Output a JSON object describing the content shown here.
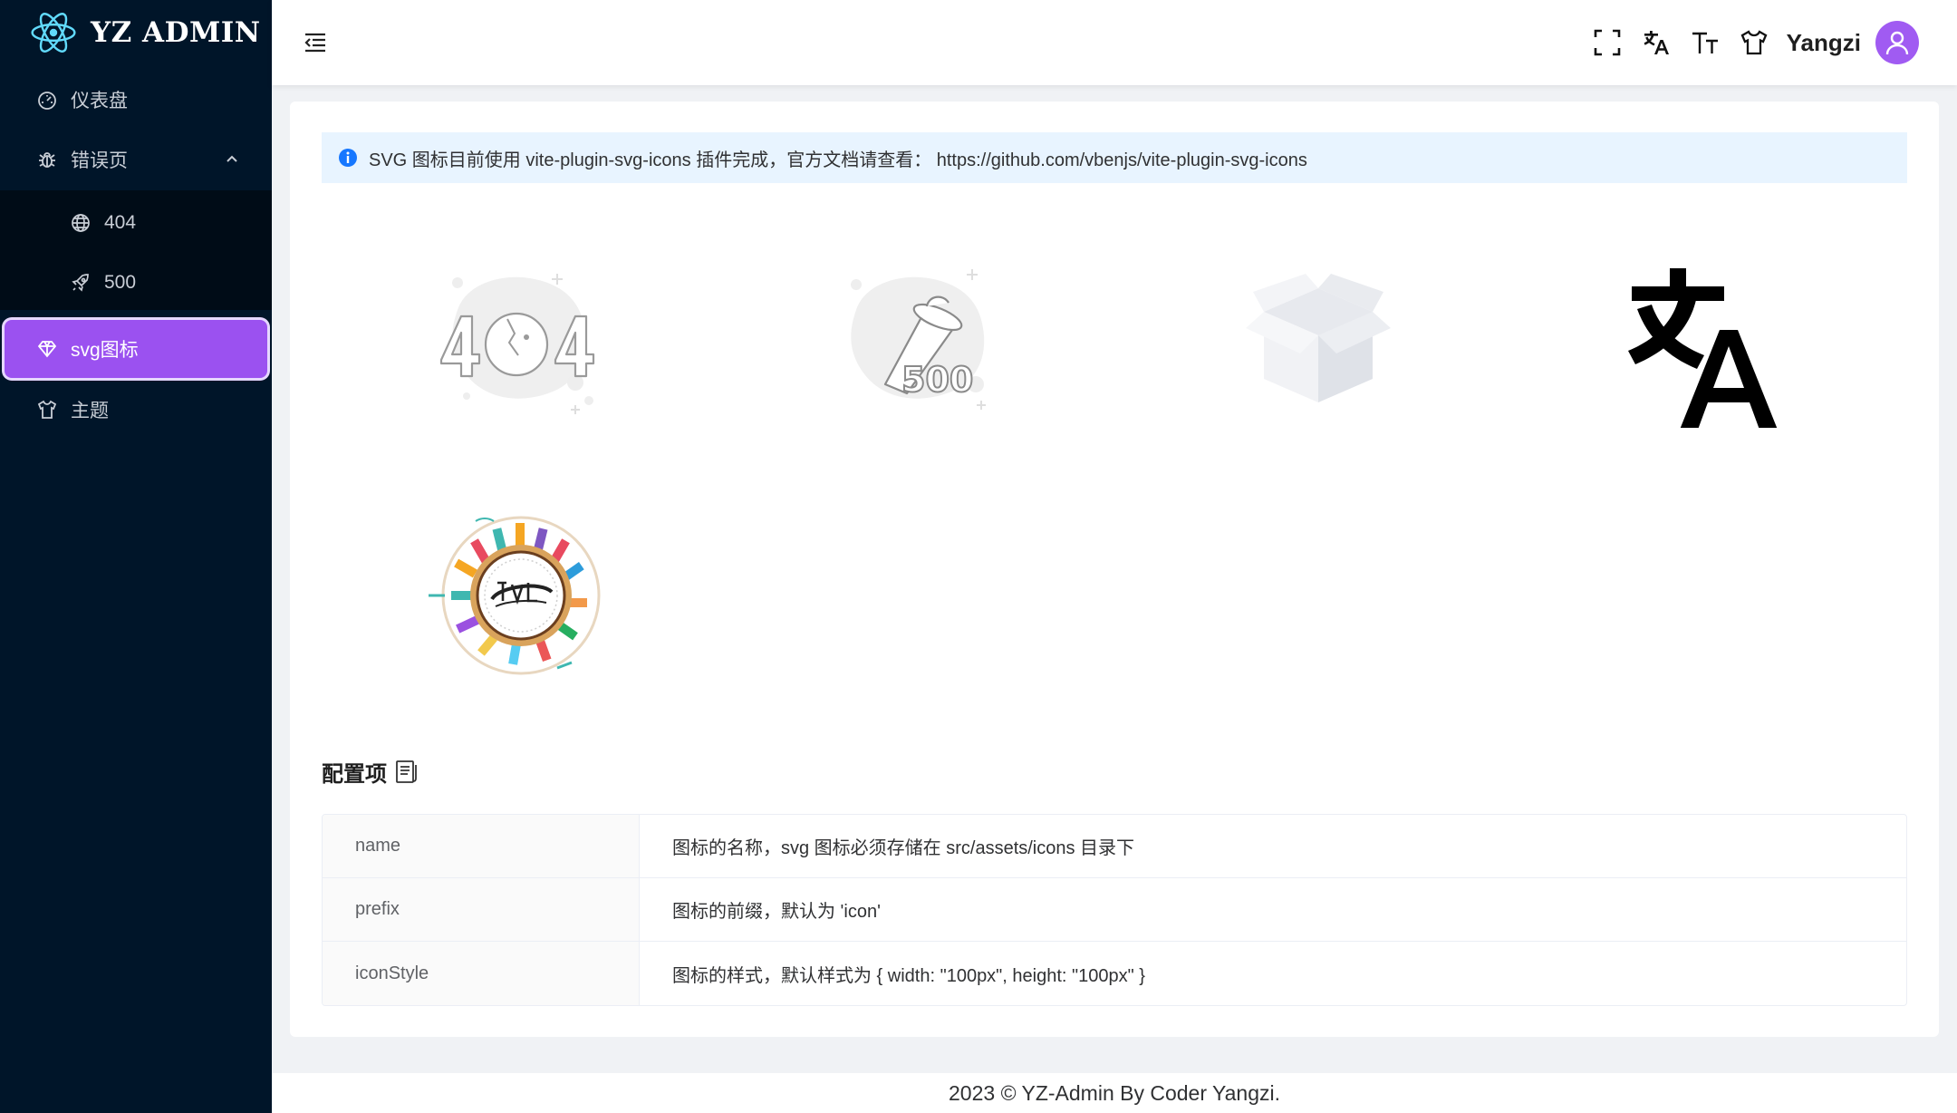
{
  "app": {
    "logo_text": "YZ ADMIN"
  },
  "sidebar": {
    "items": [
      {
        "label": "仪表盘",
        "icon": "dashboard-icon"
      },
      {
        "label": "错误页",
        "icon": "bug-icon",
        "expanded": true,
        "children": [
          {
            "label": "404",
            "icon": "globe-icon"
          },
          {
            "label": "500",
            "icon": "rocket-icon"
          }
        ]
      },
      {
        "label": "svg图标",
        "icon": "diamond-icon",
        "active": true
      },
      {
        "label": "主题",
        "icon": "shirt-icon"
      }
    ]
  },
  "header": {
    "tools": [
      "fullscreen-icon",
      "translate-icon",
      "font-size-icon",
      "theme-shirt-icon"
    ],
    "username": "Yangzi"
  },
  "alert": {
    "text": "SVG 图标目前使用 vite-plugin-svg-icons 插件完成，官方文档请查看： https://github.com/vbenjs/vite-plugin-svg-icons"
  },
  "icons": [
    "404-illustration-icon",
    "500-illustration-icon",
    "empty-box-icon",
    "translate-large-icon",
    "traveler-globe-icon"
  ],
  "config": {
    "title": "配置项",
    "rows": [
      {
        "label": "name",
        "value": "图标的名称，svg 图标必须存储在 src/assets/icons 目录下"
      },
      {
        "label": "prefix",
        "value": "图标的前缀，默认为 'icon'"
      },
      {
        "label": "iconStyle",
        "value": "图标的样式，默认样式为 { width: \"100px\", height: \"100px\" }"
      }
    ]
  },
  "footer": {
    "text": "2023 © YZ-Admin By Coder Yangzi."
  },
  "colors": {
    "sidebar_bg": "#001529",
    "active_bg": "#9b51f0",
    "alert_bg": "#e8f4ff",
    "avatar_bg": "#a05bf2"
  }
}
